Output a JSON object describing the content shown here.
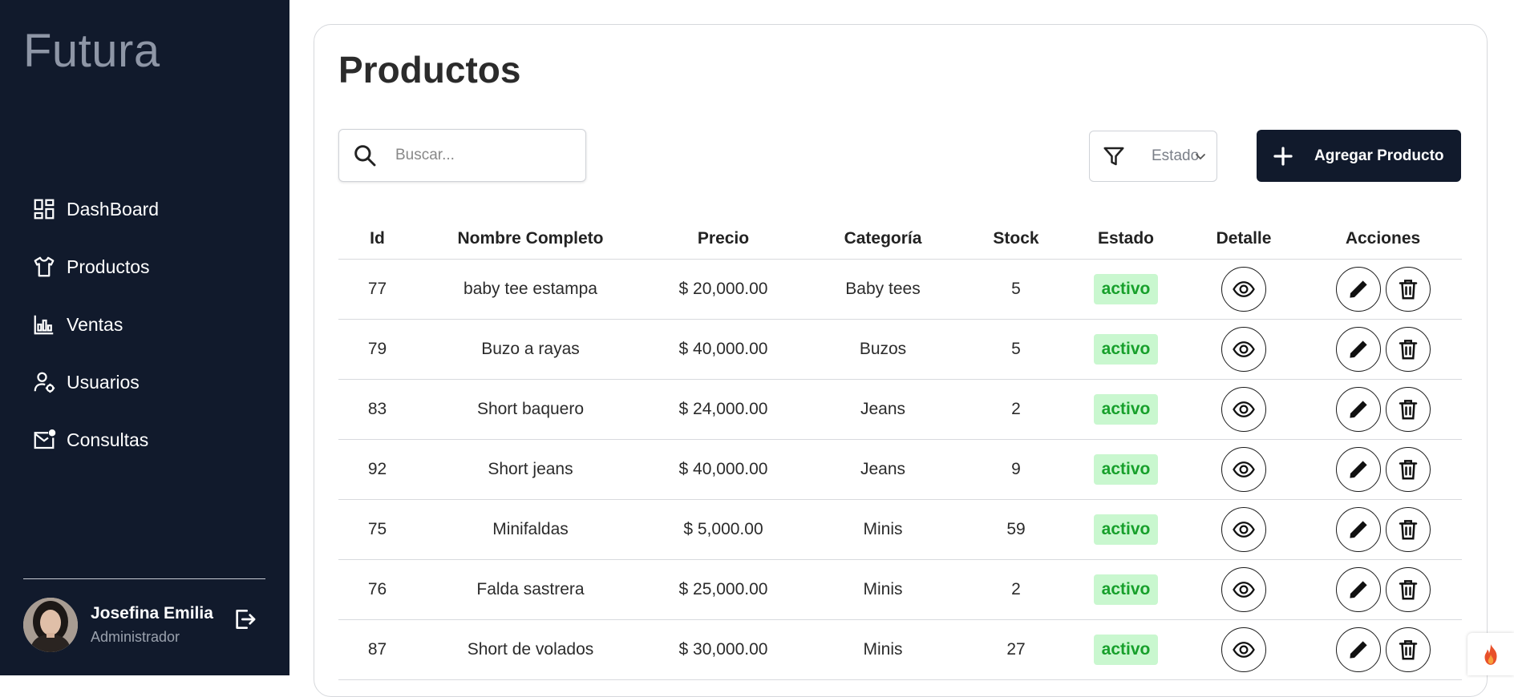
{
  "brand": "Futura",
  "nav": [
    {
      "label": "DashBoard",
      "icon": "dashboard-icon"
    },
    {
      "label": "Productos",
      "icon": "shirt-icon"
    },
    {
      "label": "Ventas",
      "icon": "bar-chart-icon"
    },
    {
      "label": "Usuarios",
      "icon": "user-gear-icon"
    },
    {
      "label": "Consultas",
      "icon": "mail-notification-icon"
    }
  ],
  "user": {
    "name": "Josefina Emilia",
    "role": "Administrador"
  },
  "page": {
    "title": "Productos"
  },
  "search": {
    "placeholder": "Buscar..."
  },
  "filter": {
    "label": "Estado"
  },
  "add_button": {
    "label": "Agregar Producto"
  },
  "table": {
    "headers": [
      "Id",
      "Nombre Completo",
      "Precio",
      "Categoría",
      "Stock",
      "Estado",
      "Detalle",
      "Acciones"
    ],
    "rows": [
      {
        "id": "77",
        "name": "baby tee estampa",
        "price": "$ 20,000.00",
        "category": "Baby tees",
        "stock": "5",
        "status": "activo"
      },
      {
        "id": "79",
        "name": "Buzo a rayas",
        "price": "$ 40,000.00",
        "category": "Buzos",
        "stock": "5",
        "status": "activo"
      },
      {
        "id": "83",
        "name": "Short baquero",
        "price": "$ 24,000.00",
        "category": "Jeans",
        "stock": "2",
        "status": "activo"
      },
      {
        "id": "92",
        "name": "Short jeans",
        "price": "$ 40,000.00",
        "category": "Jeans",
        "stock": "9",
        "status": "activo"
      },
      {
        "id": "75",
        "name": "Minifaldas",
        "price": "$ 5,000.00",
        "category": "Minis",
        "stock": "59",
        "status": "activo"
      },
      {
        "id": "76",
        "name": "Falda sastrera",
        "price": "$ 25,000.00",
        "category": "Minis",
        "stock": "2",
        "status": "activo"
      },
      {
        "id": "87",
        "name": "Short de volados",
        "price": "$ 30,000.00",
        "category": "Minis",
        "stock": "27",
        "status": "activo"
      }
    ]
  },
  "colors": {
    "sidebar": "#111a2c",
    "status_bg": "#c9f7cf",
    "status_text": "#17a02b",
    "primary": "#111a2c"
  }
}
